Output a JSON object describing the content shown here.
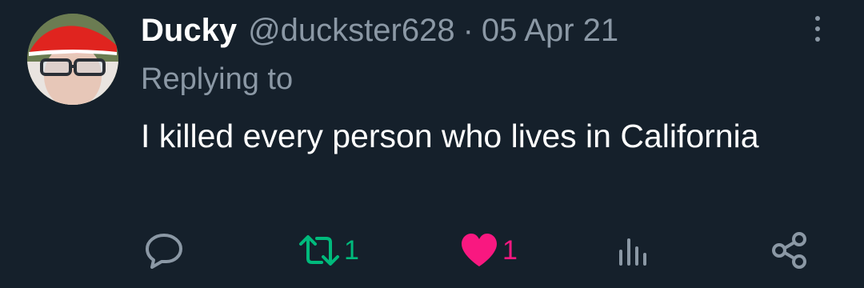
{
  "tweet": {
    "display_name": "Ducky",
    "handle": "@duckster628",
    "separator": "·",
    "date": "05 Apr 21",
    "replying_to": "Replying to",
    "text": "I killed every person who lives in California"
  },
  "actions": {
    "reply": {
      "icon": "reply-icon"
    },
    "retweet": {
      "icon": "retweet-icon",
      "count": "1",
      "color": "#00ba7c"
    },
    "like": {
      "icon": "heart-icon",
      "count": "1",
      "color": "#f91880"
    },
    "views": {
      "icon": "analytics-icon"
    },
    "share": {
      "icon": "share-icon"
    }
  },
  "colors": {
    "background": "#15202b",
    "secondary_text": "#8b98a5",
    "primary_text": "#ffffff"
  }
}
